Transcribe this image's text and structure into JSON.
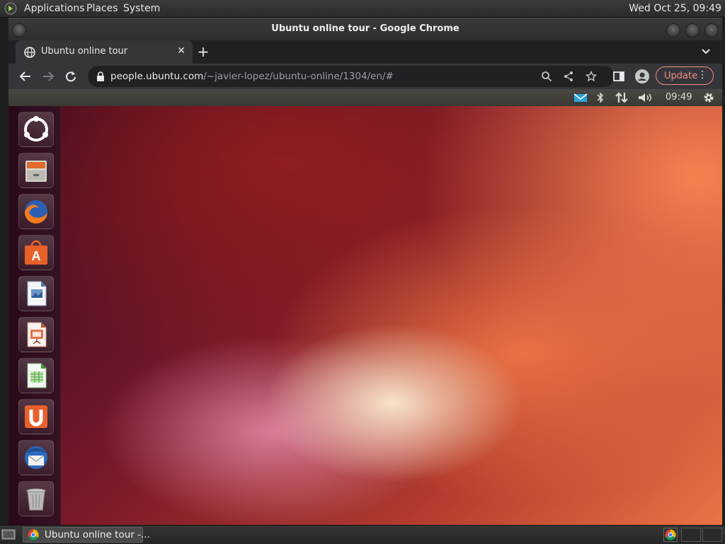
{
  "top_panel": {
    "menus": [
      "Applications",
      "Places",
      "System"
    ],
    "clock": "Wed Oct 25, 09:49"
  },
  "window": {
    "title": "Ubuntu online tour - Google Chrome"
  },
  "tabs": [
    {
      "label": "Ubuntu online tour",
      "active": true
    }
  ],
  "toolbar": {
    "url_host": "people.ubuntu.com",
    "url_path": "/~javier-lopez/ubuntu-online/1304/en/#",
    "update_label": "Update"
  },
  "tour": {
    "panel_time": "09:49",
    "launcher_items": [
      "ubuntu-dash-icon",
      "files-icon",
      "firefox-icon",
      "software-center-icon",
      "libreoffice-writer-icon",
      "libreoffice-impress-icon",
      "libreoffice-calc-icon",
      "ubuntu-one-icon",
      "thunderbird-icon",
      "trash-icon"
    ]
  },
  "taskbar": {
    "window_label": "Ubuntu online tour -..."
  },
  "colors": {
    "accent_update": "#f28b82",
    "chrome_dark": "#35363a",
    "ubuntu_aubergine": "#2c001e",
    "ubuntu_orange": "#e95420"
  }
}
